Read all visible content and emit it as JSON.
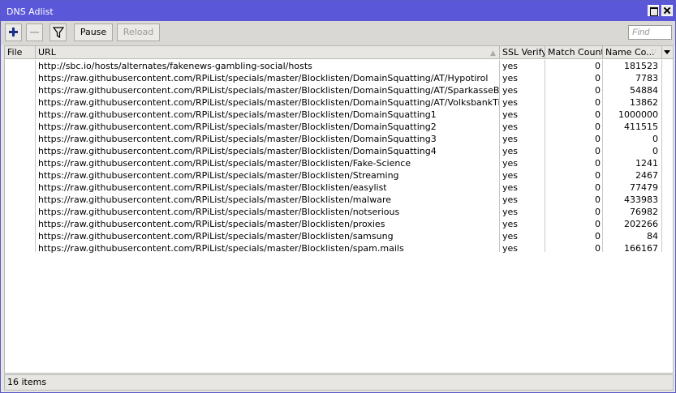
{
  "window": {
    "title": "DNS Adlist"
  },
  "toolbar": {
    "pause_label": "Pause",
    "reload_label": "Reload",
    "find_placeholder": "Find"
  },
  "table": {
    "columns": [
      "File",
      "URL",
      "SSL Verify",
      "Match Count",
      "Name Co..."
    ],
    "rows": [
      {
        "file": "",
        "url": "http://sbc.io/hosts/alternates/fakenews-gambling-social/hosts",
        "ssl": "yes",
        "match": "0",
        "name": "181523"
      },
      {
        "file": "",
        "url": "https://raw.githubusercontent.com/RPiList/specials/master/Blocklisten/DomainSquatting/AT/Hypotirol",
        "ssl": "yes",
        "match": "0",
        "name": "7783"
      },
      {
        "file": "",
        "url": "https://raw.githubusercontent.com/RPiList/specials/master/Blocklisten/DomainSquatting/AT/SparkasseBank",
        "ssl": "yes",
        "match": "0",
        "name": "54884"
      },
      {
        "file": "",
        "url": "https://raw.githubusercontent.com/RPiList/specials/master/Blocklisten/DomainSquatting/AT/VolksbankTirol",
        "ssl": "yes",
        "match": "0",
        "name": "13862"
      },
      {
        "file": "",
        "url": "https://raw.githubusercontent.com/RPiList/specials/master/Blocklisten/DomainSquatting1",
        "ssl": "yes",
        "match": "0",
        "name": "1000000"
      },
      {
        "file": "",
        "url": "https://raw.githubusercontent.com/RPiList/specials/master/Blocklisten/DomainSquatting2",
        "ssl": "yes",
        "match": "0",
        "name": "411515"
      },
      {
        "file": "",
        "url": "https://raw.githubusercontent.com/RPiList/specials/master/Blocklisten/DomainSquatting3",
        "ssl": "yes",
        "match": "0",
        "name": "0"
      },
      {
        "file": "",
        "url": "https://raw.githubusercontent.com/RPiList/specials/master/Blocklisten/DomainSquatting4",
        "ssl": "yes",
        "match": "0",
        "name": "0"
      },
      {
        "file": "",
        "url": "https://raw.githubusercontent.com/RPiList/specials/master/Blocklisten/Fake-Science",
        "ssl": "yes",
        "match": "0",
        "name": "1241"
      },
      {
        "file": "",
        "url": "https://raw.githubusercontent.com/RPiList/specials/master/Blocklisten/Streaming",
        "ssl": "yes",
        "match": "0",
        "name": "2467"
      },
      {
        "file": "",
        "url": "https://raw.githubusercontent.com/RPiList/specials/master/Blocklisten/easylist",
        "ssl": "yes",
        "match": "0",
        "name": "77479"
      },
      {
        "file": "",
        "url": "https://raw.githubusercontent.com/RPiList/specials/master/Blocklisten/malware",
        "ssl": "yes",
        "match": "0",
        "name": "433983"
      },
      {
        "file": "",
        "url": "https://raw.githubusercontent.com/RPiList/specials/master/Blocklisten/notserious",
        "ssl": "yes",
        "match": "0",
        "name": "76982"
      },
      {
        "file": "",
        "url": "https://raw.githubusercontent.com/RPiList/specials/master/Blocklisten/proxies",
        "ssl": "yes",
        "match": "0",
        "name": "202266"
      },
      {
        "file": "",
        "url": "https://raw.githubusercontent.com/RPiList/specials/master/Blocklisten/samsung",
        "ssl": "yes",
        "match": "0",
        "name": "84"
      },
      {
        "file": "",
        "url": "https://raw.githubusercontent.com/RPiList/specials/master/Blocklisten/spam.mails",
        "ssl": "yes",
        "match": "0",
        "name": "166167"
      }
    ]
  },
  "status": {
    "text": "16 items"
  },
  "icons": {
    "add": "plus-icon",
    "remove": "minus-icon",
    "filter": "filter-icon",
    "restore": "restore-window-icon",
    "close": "close-icon"
  },
  "colors": {
    "titlebar": "#5a58d8",
    "add_icon": "#1a2e8a"
  }
}
